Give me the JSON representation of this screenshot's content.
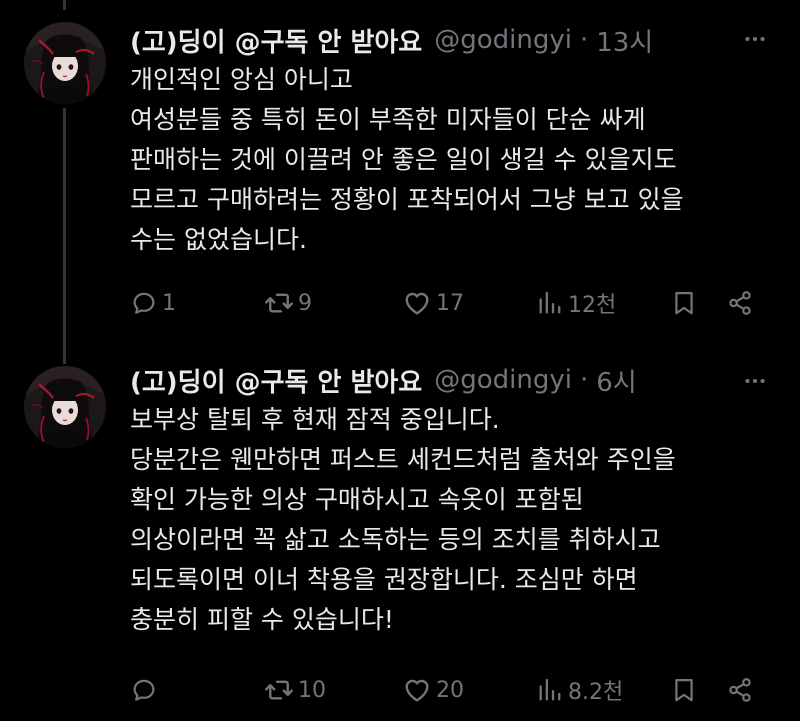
{
  "colors": {
    "background": "#000000",
    "text": "#e7e9ea",
    "secondary": "#71767b",
    "thread_line": "#333639"
  },
  "tweets": [
    {
      "display_name": "(고)딩이 @구독 안 받아요",
      "handle": "@godingyi",
      "separator": "·",
      "time": "13시",
      "text_lines": [
        "개인적인 앙심 아니고",
        "여성분들 중 특히 돈이 부족한 미자들이 단순 싸게",
        "판매하는 것에 이끌려 안 좋은 일이 생길 수 있을지도",
        "모르고 구매하려는 정황이 포착되어서 그냥 보고 있을",
        "수는 없었습니다."
      ],
      "replies": "1",
      "retweets": "9",
      "likes": "17",
      "views": "12천",
      "icons": [
        "reply-icon",
        "retweet-icon",
        "like-icon",
        "views-icon",
        "bookmark-icon",
        "share-icon",
        "more-icon"
      ]
    },
    {
      "display_name": "(고)딩이 @구독 안 받아요",
      "handle": "@godingyi",
      "separator": "·",
      "time": "6시",
      "text_lines": [
        "보부상 탈퇴 후 현재 잠적 중입니다.",
        "당분간은 웬만하면 퍼스트 세컨드처럼 출처와 주인을",
        "확인 가능한 의상 구매하시고 속옷이 포함된",
        "의상이라면 꼭 삶고 소독하는 등의 조치를 취하시고",
        "되도록이면 이너 착용을 권장합니다. 조심만 하면",
        "충분히 피할 수 있습니다!"
      ],
      "replies": "",
      "retweets": "10",
      "likes": "20",
      "views": "8.2천",
      "icons": [
        "reply-icon",
        "retweet-icon",
        "like-icon",
        "views-icon",
        "bookmark-icon",
        "share-icon",
        "more-icon"
      ]
    }
  ]
}
